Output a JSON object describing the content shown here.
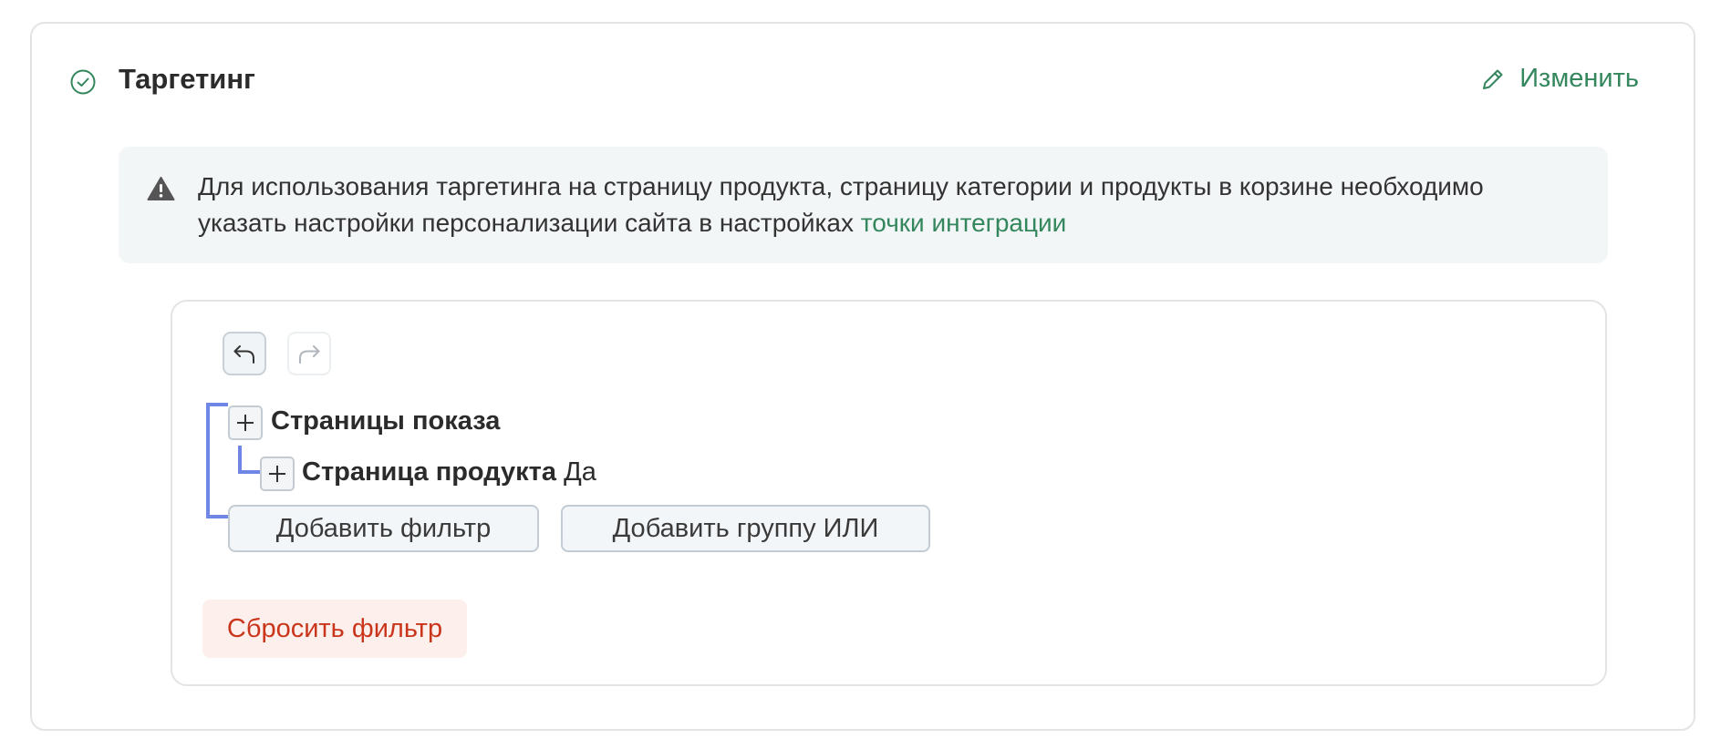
{
  "section": {
    "title": "Таргетинг",
    "edit_label": "Изменить"
  },
  "alert": {
    "text": "Для использования таргетинга на страницу продукта, страницу категории и продукты в корзине необходимо указать настройки персонализации сайта в настройках ",
    "link_text": "точки интеграции"
  },
  "filter": {
    "group": {
      "label": "Страницы показа",
      "children": [
        {
          "label": "Страница продукта",
          "value": "Да"
        }
      ]
    },
    "add_filter_label": "Добавить фильтр",
    "add_or_group_label": "Добавить группу ИЛИ",
    "reset_label": "Сбросить фильтр"
  },
  "colors": {
    "accent": "#34875d",
    "tree_line": "#6f86e5",
    "danger": "#c9361c",
    "danger_bg": "#fcefec"
  }
}
